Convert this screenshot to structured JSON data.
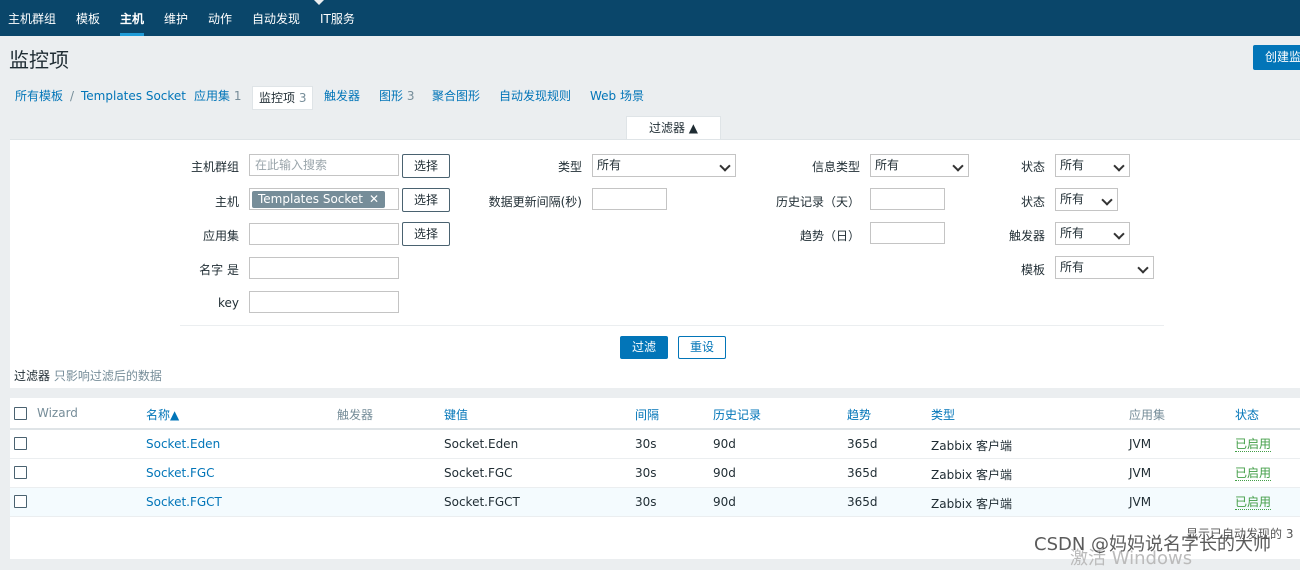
{
  "topnav": {
    "items": [
      "主机群组",
      "模板",
      "主机",
      "维护",
      "动作",
      "自动发现",
      "IT服务"
    ],
    "active_index": 2
  },
  "page": {
    "title": "监控项",
    "create_button": "创建监"
  },
  "breadcrumb": {
    "all_templates": "所有模板",
    "separator": "/",
    "template": "Templates Socket"
  },
  "tabs": [
    {
      "label": "应用集",
      "count": "1"
    },
    {
      "label": "监控项",
      "count": "3",
      "active": true
    },
    {
      "label": "触发器",
      "count": ""
    },
    {
      "label": "图形",
      "count": "3"
    },
    {
      "label": "聚合图形",
      "count": ""
    },
    {
      "label": "自动发现规则",
      "count": ""
    },
    {
      "label": "Web 场景",
      "count": ""
    }
  ],
  "filter": {
    "tab_label": "过滤器 ▲",
    "host_group_label": "主机群组",
    "host_group_placeholder": "在此输入搜索",
    "host_label": "主机",
    "host_chip": "Templates Socket",
    "app_label": "应用集",
    "name_label": "名字 是",
    "key_label": "key",
    "select_button": "选择",
    "type_label": "类型",
    "type_value": "所有",
    "interval_label": "数据更新间隔(秒)",
    "info_type_label": "信息类型",
    "info_type_value": "所有",
    "history_label": "历史记录（天）",
    "trends_label": "趋势（日）",
    "state_label": "状态",
    "state_value": "所有",
    "status_label": "状态",
    "status_value": "所有",
    "triggers_label": "触发器",
    "triggers_value": "所有",
    "template_label": "模板",
    "template_value": "所有",
    "apply_button": "过滤",
    "reset_button": "重设",
    "note_title": "过滤器",
    "note_text": "只影响过滤后的数据"
  },
  "table": {
    "headers": {
      "wizard": "Wizard",
      "name": "名称▲",
      "triggers": "触发器",
      "key": "键值",
      "interval": "间隔",
      "history": "历史记录",
      "trends": "趋势",
      "type": "类型",
      "applications": "应用集",
      "status": "状态"
    },
    "rows": [
      {
        "name": "Socket.Eden",
        "key": "Socket.Eden",
        "interval": "30s",
        "history": "90d",
        "trends": "365d",
        "type": "Zabbix 客户端",
        "app": "JVM",
        "status": "已启用"
      },
      {
        "name": "Socket.FGC",
        "key": "Socket.FGC",
        "interval": "30s",
        "history": "90d",
        "trends": "365d",
        "type": "Zabbix 客户端",
        "app": "JVM",
        "status": "已启用"
      },
      {
        "name": "Socket.FGCT",
        "key": "Socket.FGCT",
        "interval": "30s",
        "history": "90d",
        "trends": "365d",
        "type": "Zabbix 客户端",
        "app": "JVM",
        "status": "已启用"
      }
    ],
    "footer_text": "显示已自动发现的 3"
  },
  "watermark": {
    "csdn": "CSDN @妈妈说名字长的大帅",
    "windows": "激活 Windows"
  }
}
